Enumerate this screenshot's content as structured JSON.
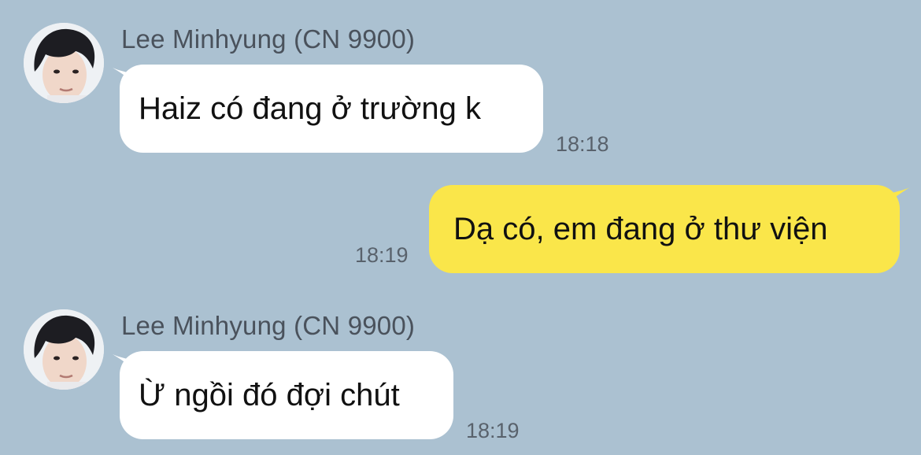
{
  "chat": {
    "messages": [
      {
        "direction": "incoming",
        "sender": "Lee Minhyung (CN 9900)",
        "avatar_icon": "profile-photo",
        "text": "Haiz có đang ở trường k",
        "time": "18:18"
      },
      {
        "direction": "outgoing",
        "text": "Dạ có, em đang ở thư viện",
        "time": "18:19"
      },
      {
        "direction": "incoming",
        "sender": "Lee Minhyung (CN 9900)",
        "avatar_icon": "profile-photo",
        "text": "Ừ ngồi đó đợi chút",
        "time": "18:19"
      }
    ]
  },
  "colors": {
    "background": "#abc1d1",
    "incoming_bubble": "#ffffff",
    "outgoing_bubble": "#fae64a",
    "sender_text": "#4a525c",
    "time_text": "#59626c"
  }
}
